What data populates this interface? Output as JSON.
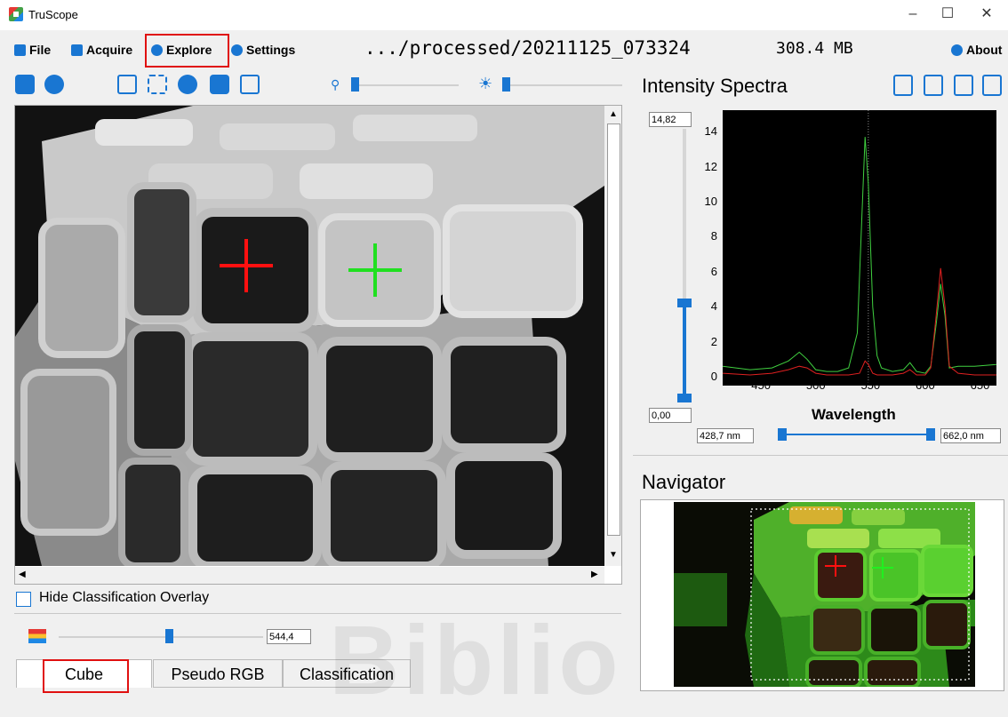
{
  "window": {
    "title": "TruScope",
    "controls": [
      "–",
      "☐",
      "✕"
    ]
  },
  "menu": {
    "items": [
      {
        "label": "File",
        "icon": "file-icon"
      },
      {
        "label": "Acquire",
        "icon": "camera-icon"
      },
      {
        "label": "Explore",
        "icon": "compass-icon"
      },
      {
        "label": "Settings",
        "icon": "gear-icon"
      }
    ],
    "about": "About"
  },
  "status": {
    "path": ".../processed/20211125_073324",
    "size": "308.4 MB"
  },
  "spectrum": {
    "title": "Intensity Spectra",
    "ymax": "14,82",
    "ymin": "0,00",
    "range_min": "428,7 nm",
    "range_max": "662,0 nm"
  },
  "chart_data": {
    "type": "line",
    "xlabel": "Wavelength",
    "ylabel": "",
    "xlim": [
      415,
      665
    ],
    "ylim": [
      0,
      14.82
    ],
    "xticks": [
      "450",
      "500",
      "550",
      "600",
      "650"
    ],
    "yticks": [
      "0",
      "2",
      "4",
      "6",
      "8",
      "10",
      "12",
      "14"
    ],
    "series": [
      {
        "color": "#40d040",
        "x": [
          415,
          440,
          460,
          475,
          485,
          492,
          500,
          510,
          520,
          530,
          538,
          542,
          545,
          548,
          552,
          556,
          560,
          570,
          580,
          586,
          592,
          600,
          605,
          610,
          614,
          618,
          622,
          630,
          645,
          665
        ],
        "y": [
          0.6,
          0.4,
          0.5,
          0.9,
          1.4,
          1.0,
          0.4,
          0.3,
          0.3,
          0.5,
          2.5,
          9.0,
          13.7,
          11.0,
          4.0,
          1.2,
          0.5,
          0.3,
          0.4,
          0.8,
          0.3,
          0.2,
          0.6,
          3.0,
          5.3,
          3.5,
          0.5,
          0.6,
          0.6,
          0.7
        ]
      },
      {
        "color": "#e02020",
        "x": [
          415,
          440,
          460,
          475,
          485,
          492,
          500,
          510,
          520,
          530,
          540,
          545,
          548,
          552,
          556,
          560,
          570,
          580,
          586,
          592,
          600,
          605,
          610,
          614,
          618,
          622,
          630,
          645,
          665
        ],
        "y": [
          0.2,
          0.1,
          0.2,
          0.4,
          0.6,
          0.5,
          0.2,
          0.1,
          0.1,
          0.1,
          0.2,
          0.9,
          0.7,
          0.2,
          0.1,
          0.1,
          0.1,
          0.2,
          0.4,
          0.1,
          0.1,
          0.5,
          3.5,
          6.2,
          4.0,
          0.6,
          0.2,
          0.1,
          0.1
        ]
      }
    ]
  },
  "navigator": {
    "title": "Navigator"
  },
  "overlay": {
    "label": "Hide Classification Overlay"
  },
  "band": {
    "value": "544,4"
  },
  "tabs": [
    "Cube",
    "Pseudo RGB",
    "Classification"
  ],
  "colors": {
    "accent": "#1976d2",
    "highlight": "#e01010"
  }
}
